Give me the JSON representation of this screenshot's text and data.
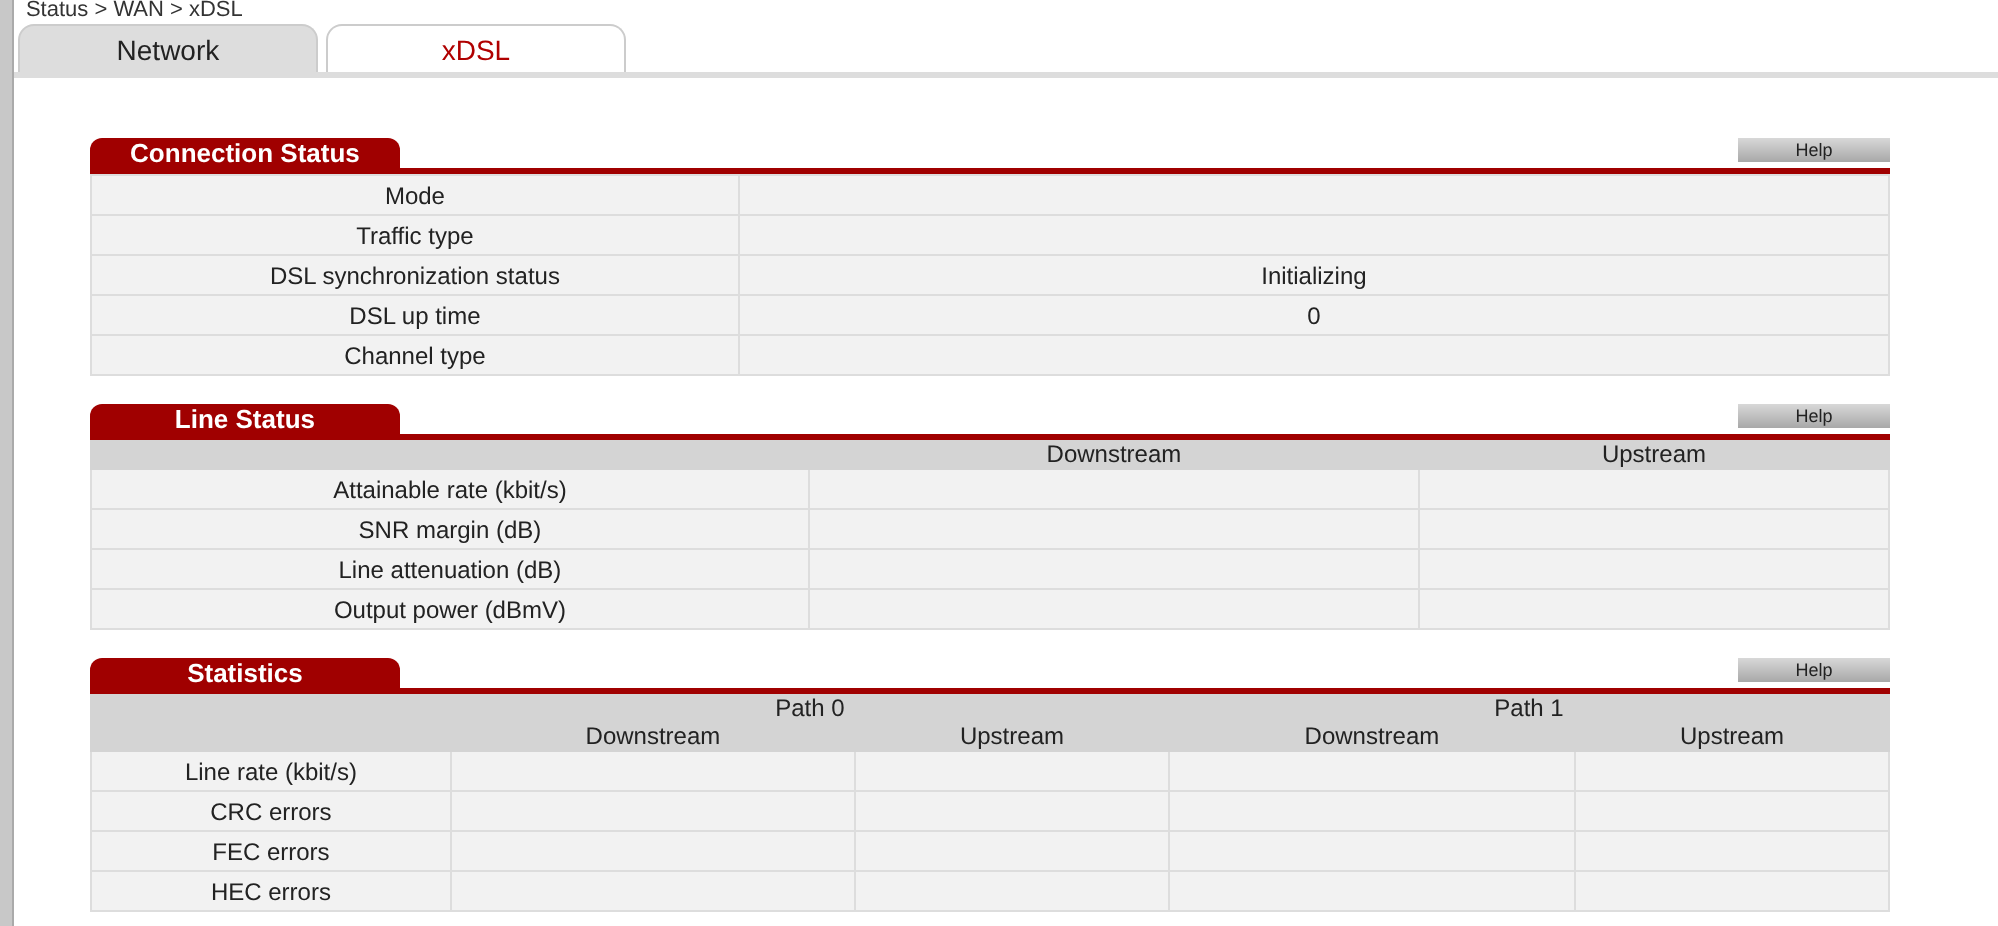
{
  "breadcrumb": "Status > WAN > xDSL",
  "tabs": [
    {
      "label": "Network",
      "selected": false
    },
    {
      "label": "xDSL",
      "selected": true
    }
  ],
  "sections": [
    {
      "kind": "keyvalue",
      "title": "Connection Status",
      "help": "Help",
      "rows": [
        {
          "label": "Mode"
        },
        {
          "label": "Traffic type"
        },
        {
          "label": "DSL synchronization status",
          "value": "Initializing"
        },
        {
          "label": "DSL up time",
          "value": "0"
        },
        {
          "label": "Channel type"
        }
      ]
    },
    {
      "kind": "grid",
      "title": "Line Status",
      "help": "Help",
      "columns": [
        "Downstream",
        "Upstream"
      ],
      "rows": [
        {
          "label": "Attainable rate (kbit/s)"
        },
        {
          "label": "SNR margin (dB)"
        },
        {
          "label": "Line attenuation (dB)"
        },
        {
          "label": "Output power (dBmV)"
        }
      ]
    },
    {
      "kind": "paths",
      "title": "Statistics",
      "help": "Help",
      "paths": [
        {
          "label": "Path 0",
          "columns": [
            "Downstream",
            "Upstream"
          ]
        },
        {
          "label": "Path 1",
          "columns": [
            "Downstream",
            "Upstream"
          ]
        }
      ],
      "rows": [
        {
          "label": "Line rate (kbit/s)"
        },
        {
          "label": "CRC errors"
        },
        {
          "label": "FEC errors"
        },
        {
          "label": "HEC errors"
        }
      ]
    }
  ]
}
